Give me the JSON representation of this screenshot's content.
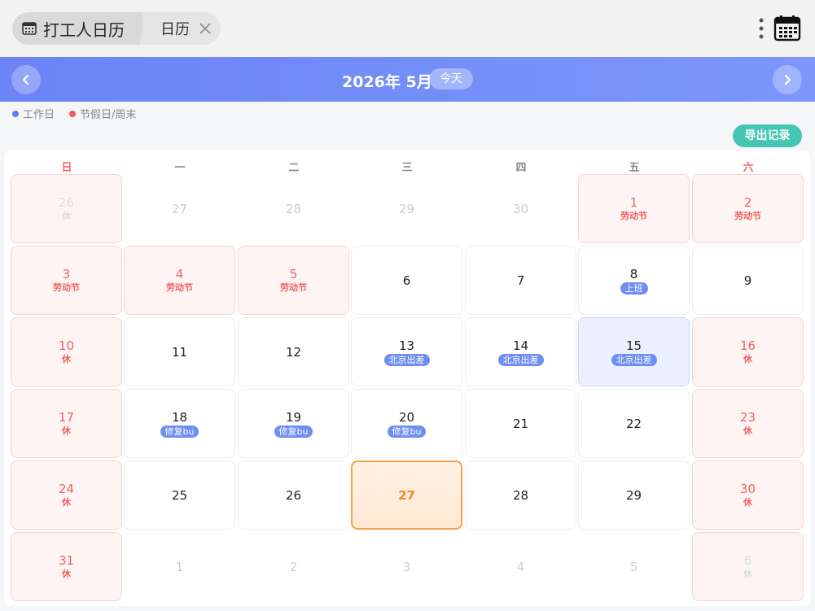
{
  "tabs": {
    "main_label": "打工人日历",
    "sub_label": "日历"
  },
  "header": {
    "title": "2026年 5月",
    "today_label": "今天"
  },
  "legend": [
    {
      "label": "工作日",
      "color": "#5b7cf2"
    },
    {
      "label": "节假日/周末",
      "color": "#ef5b5b"
    }
  ],
  "export_label": "导出记录",
  "weekdays": [
    "日",
    "一",
    "二",
    "三",
    "四",
    "五",
    "六"
  ],
  "colors": {
    "accent": "#6b84f6",
    "holiday": "#ef6161",
    "today": "#f7a24a",
    "export": "#45c6b3"
  },
  "days": [
    {
      "n": "26",
      "sub": "休",
      "kind": "other-holiday"
    },
    {
      "n": "27",
      "kind": "other"
    },
    {
      "n": "28",
      "kind": "other"
    },
    {
      "n": "29",
      "kind": "other"
    },
    {
      "n": "30",
      "kind": "other"
    },
    {
      "n": "1",
      "sub": "劳动节",
      "kind": "holiday"
    },
    {
      "n": "2",
      "sub": "劳动节",
      "kind": "holiday"
    },
    {
      "n": "3",
      "sub": "劳动节",
      "kind": "holiday"
    },
    {
      "n": "4",
      "sub": "劳动节",
      "kind": "holiday"
    },
    {
      "n": "5",
      "sub": "劳动节",
      "kind": "holiday"
    },
    {
      "n": "6",
      "kind": "work"
    },
    {
      "n": "7",
      "kind": "work"
    },
    {
      "n": "8",
      "badge": "上班",
      "kind": "work"
    },
    {
      "n": "9",
      "kind": "work"
    },
    {
      "n": "10",
      "sub": "休",
      "kind": "holiday"
    },
    {
      "n": "11",
      "kind": "work"
    },
    {
      "n": "12",
      "kind": "work"
    },
    {
      "n": "13",
      "badge": "北京出差",
      "kind": "work"
    },
    {
      "n": "14",
      "badge": "北京出差",
      "kind": "work"
    },
    {
      "n": "15",
      "badge": "北京出差",
      "kind": "selected"
    },
    {
      "n": "16",
      "sub": "休",
      "kind": "holiday"
    },
    {
      "n": "17",
      "sub": "休",
      "kind": "holiday"
    },
    {
      "n": "18",
      "badge": "修复bu",
      "kind": "work"
    },
    {
      "n": "19",
      "badge": "修复bu",
      "kind": "work"
    },
    {
      "n": "20",
      "badge": "修复bu",
      "kind": "work"
    },
    {
      "n": "21",
      "kind": "work"
    },
    {
      "n": "22",
      "kind": "work"
    },
    {
      "n": "23",
      "sub": "休",
      "kind": "holiday"
    },
    {
      "n": "24",
      "sub": "休",
      "kind": "holiday"
    },
    {
      "n": "25",
      "kind": "work"
    },
    {
      "n": "26",
      "kind": "work"
    },
    {
      "n": "27",
      "kind": "today"
    },
    {
      "n": "28",
      "kind": "work"
    },
    {
      "n": "29",
      "kind": "work"
    },
    {
      "n": "30",
      "sub": "休",
      "kind": "holiday"
    },
    {
      "n": "31",
      "sub": "休",
      "kind": "holiday"
    },
    {
      "n": "1",
      "kind": "other"
    },
    {
      "n": "2",
      "kind": "other"
    },
    {
      "n": "3",
      "kind": "other"
    },
    {
      "n": "4",
      "kind": "other"
    },
    {
      "n": "5",
      "kind": "other"
    },
    {
      "n": "6",
      "sub": "休",
      "kind": "other-holiday"
    }
  ]
}
